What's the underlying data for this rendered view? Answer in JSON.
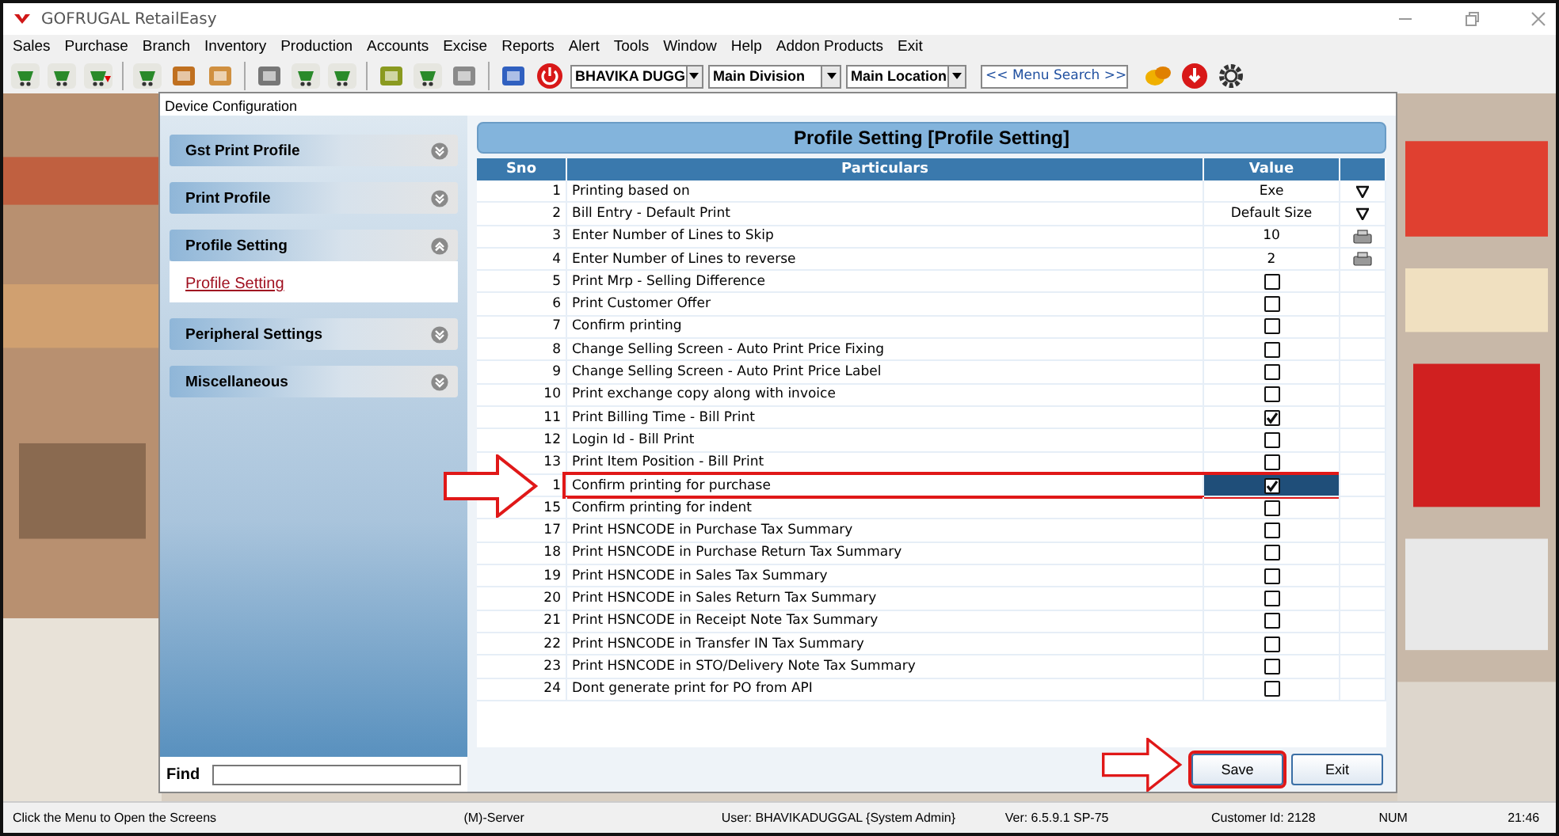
{
  "window": {
    "title": "GOFRUGAL RetailEasy"
  },
  "menu": [
    "Sales",
    "Purchase",
    "Branch",
    "Inventory",
    "Production",
    "Accounts",
    "Excise",
    "Reports",
    "Alert",
    "Tools",
    "Window",
    "Help",
    "Addon Products",
    "Exit"
  ],
  "toolbar": {
    "user": "BHAVIKA DUGG",
    "division": "Main Division",
    "location": "Main Location",
    "menu_search": "<< Menu Search >>"
  },
  "dialog": {
    "title": "Device Configuration",
    "sections": [
      {
        "label": "Gst Print Profile",
        "expanded": false
      },
      {
        "label": "Print Profile",
        "expanded": false
      },
      {
        "label": "Profile Setting",
        "expanded": true,
        "children": [
          {
            "label": "Profile Setting",
            "selected": true
          }
        ]
      },
      {
        "label": "Peripheral Settings",
        "expanded": false
      },
      {
        "label": "Miscellaneous",
        "expanded": false
      }
    ],
    "find": {
      "label": "Find"
    },
    "panel_title": "Profile Setting [Profile Setting]",
    "table": {
      "columns": [
        "Sno",
        "Particulars",
        "Value"
      ],
      "rows": [
        {
          "sno": "1",
          "particular": "Printing based on",
          "kind": "select",
          "value": "Exe",
          "selected": false,
          "annotated": false
        },
        {
          "sno": "2",
          "particular": "Bill Entry -  Default Print",
          "kind": "select",
          "value": "Default Size",
          "selected": false,
          "annotated": false
        },
        {
          "sno": "3",
          "particular": "Enter Number of Lines to Skip",
          "kind": "spin",
          "value": "10",
          "selected": false,
          "annotated": false
        },
        {
          "sno": "4",
          "particular": "Enter Number of Lines to reverse",
          "kind": "spin",
          "value": "2",
          "selected": false,
          "annotated": false
        },
        {
          "sno": "5",
          "particular": "Print Mrp - Selling Difference",
          "kind": "checkbox",
          "checked": false,
          "selected": false,
          "annotated": false
        },
        {
          "sno": "6",
          "particular": "Print Customer Offer",
          "kind": "checkbox",
          "checked": false,
          "selected": false,
          "annotated": false
        },
        {
          "sno": "7",
          "particular": "Confirm printing",
          "kind": "checkbox",
          "checked": false,
          "selected": false,
          "annotated": false
        },
        {
          "sno": "8",
          "particular": "Change Selling Screen - Auto Print Price Fixing",
          "kind": "checkbox",
          "checked": false,
          "selected": false,
          "annotated": false
        },
        {
          "sno": "9",
          "particular": "Change Selling Screen - Auto Print Price Label",
          "kind": "checkbox",
          "checked": false,
          "selected": false,
          "annotated": false
        },
        {
          "sno": "10",
          "particular": "Print exchange copy along with invoice",
          "kind": "checkbox",
          "checked": false,
          "selected": false,
          "annotated": false
        },
        {
          "sno": "11",
          "particular": "Print Billing Time - Bill Print",
          "kind": "checkbox",
          "checked": true,
          "selected": false,
          "annotated": false
        },
        {
          "sno": "12",
          "particular": "Login Id - Bill Print",
          "kind": "checkbox",
          "checked": false,
          "selected": false,
          "annotated": false
        },
        {
          "sno": "13",
          "particular": "Print Item Position - Bill Print",
          "kind": "checkbox",
          "checked": false,
          "selected": false,
          "annotated": false
        },
        {
          "sno": "1",
          "particular": "Confirm printing for purchase",
          "kind": "checkbox",
          "checked": true,
          "selected": true,
          "annotated": true
        },
        {
          "sno": "15",
          "particular": "Confirm printing for indent",
          "kind": "checkbox",
          "checked": false,
          "selected": false,
          "annotated": false
        },
        {
          "sno": "17",
          "particular": "Print HSNCODE in Purchase Tax Summary",
          "kind": "checkbox",
          "checked": false,
          "selected": false,
          "annotated": false
        },
        {
          "sno": "18",
          "particular": "Print HSNCODE in Purchase Return Tax Summary",
          "kind": "checkbox",
          "checked": false,
          "selected": false,
          "annotated": false
        },
        {
          "sno": "19",
          "particular": "Print HSNCODE in Sales Tax Summary",
          "kind": "checkbox",
          "checked": false,
          "selected": false,
          "annotated": false
        },
        {
          "sno": "20",
          "particular": "Print HSNCODE in Sales Return Tax Summary",
          "kind": "checkbox",
          "checked": false,
          "selected": false,
          "annotated": false
        },
        {
          "sno": "21",
          "particular": "Print HSNCODE in Receipt Note Tax Summary",
          "kind": "checkbox",
          "checked": false,
          "selected": false,
          "annotated": false
        },
        {
          "sno": "22",
          "particular": "Print HSNCODE in Transfer IN Tax Summary",
          "kind": "checkbox",
          "checked": false,
          "selected": false,
          "annotated": false
        },
        {
          "sno": "23",
          "particular": "Print HSNCODE in STO/Delivery Note Tax Summary",
          "kind": "checkbox",
          "checked": false,
          "selected": false,
          "annotated": false
        },
        {
          "sno": "24",
          "particular": "Dont generate print for PO from API",
          "kind": "checkbox",
          "checked": false,
          "selected": false,
          "annotated": false
        }
      ]
    },
    "buttons": [
      {
        "label": "Save",
        "annotated": true
      },
      {
        "label": "Exit",
        "annotated": false
      }
    ]
  },
  "status_bar": [
    "Click the Menu to Open the Screens",
    "(M)-Server",
    "User: BHAVIKADUGGAL {System Admin}",
    "Ver: 6.5.9.1 SP-75",
    "Customer Id: 2128",
    "NUM",
    "21:46"
  ]
}
